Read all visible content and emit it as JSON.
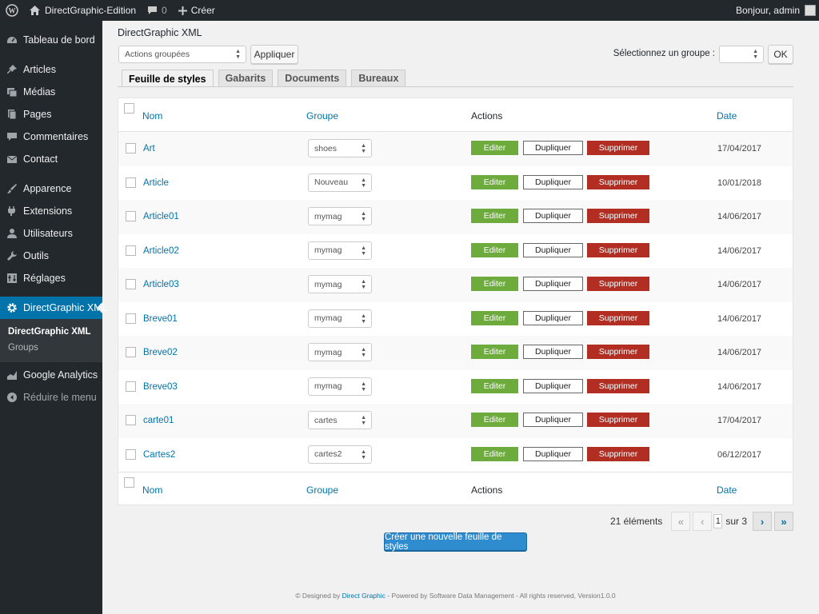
{
  "adminbar": {
    "site_name": "DirectGraphic-Edition",
    "comments_count": "0",
    "new_label": "Créer",
    "greeting": "Bonjour, admin",
    "icons": [
      "wordpress-icon",
      "home-icon",
      "comment-icon",
      "plus-icon"
    ]
  },
  "sidebar": {
    "items": [
      {
        "label": "Tableau de bord",
        "icon": "dashboard-icon"
      },
      {
        "label": "Articles",
        "icon": "pin-icon"
      },
      {
        "label": "Médias",
        "icon": "media-icon"
      },
      {
        "label": "Pages",
        "icon": "page-icon"
      },
      {
        "label": "Commentaires",
        "icon": "comment-icon"
      },
      {
        "label": "Contact",
        "icon": "mail-icon"
      },
      {
        "label": "Apparence",
        "icon": "brush-icon"
      },
      {
        "label": "Extensions",
        "icon": "plugin-icon"
      },
      {
        "label": "Utilisateurs",
        "icon": "user-icon"
      },
      {
        "label": "Outils",
        "icon": "wrench-icon"
      },
      {
        "label": "Réglages",
        "icon": "settings-icon"
      },
      {
        "label": "DirectGraphic XML",
        "icon": "gear-icon"
      },
      {
        "label": "Google Analytics",
        "icon": "analytics-icon"
      },
      {
        "label": "Réduire le menu",
        "icon": "collapse-icon"
      }
    ],
    "submenu": [
      {
        "label": "DirectGraphic XML"
      },
      {
        "label": "Groups"
      }
    ],
    "active_color": "#0073aa"
  },
  "page": {
    "heading": "DirectGraphic XML",
    "bulk_select": "Actions groupées",
    "apply_label": "Appliquer",
    "group_label": "Sélectionnez un groupe :",
    "group_select": "",
    "ok_label": "OK"
  },
  "tabs": [
    {
      "label": "Feuille de styles",
      "active": true
    },
    {
      "label": "Gabarits",
      "active": false
    },
    {
      "label": "Documents",
      "active": false
    },
    {
      "label": "Bureaux",
      "active": false
    }
  ],
  "table": {
    "columns": {
      "nom": "Nom",
      "groupe": "Groupe",
      "actions": "Actions",
      "date": "Date"
    },
    "buttons": {
      "edit": "Editer",
      "duplicate": "Dupliquer",
      "delete": "Supprimer"
    },
    "rows": [
      {
        "nom": "Art",
        "groupe": "shoes",
        "date": "17/04/2017"
      },
      {
        "nom": "Article",
        "groupe": "Nouveau",
        "date": "10/01/2018"
      },
      {
        "nom": "Article01",
        "groupe": "mymag",
        "date": "14/06/2017"
      },
      {
        "nom": "Article02",
        "groupe": "mymag",
        "date": "14/06/2017"
      },
      {
        "nom": "Article03",
        "groupe": "mymag",
        "date": "14/06/2017"
      },
      {
        "nom": "Breve01",
        "groupe": "mymag",
        "date": "14/06/2017"
      },
      {
        "nom": "Breve02",
        "groupe": "mymag",
        "date": "14/06/2017"
      },
      {
        "nom": "Breve03",
        "groupe": "mymag",
        "date": "14/06/2017"
      },
      {
        "nom": "carte01",
        "groupe": "cartes",
        "date": "17/04/2017"
      },
      {
        "nom": "Cartes2",
        "groupe": "cartes2",
        "date": "06/12/2017"
      }
    ],
    "colors": {
      "edit": "#6cab3c",
      "delete": "#b22d22"
    }
  },
  "pagination": {
    "count": "21 éléments",
    "first": "«",
    "prev": "‹",
    "current": "1",
    "of_total": "sur 3",
    "next": "›",
    "last": "»"
  },
  "create_button": "Créer une nouvelle feuille de styles",
  "footer": {
    "prefix": "© Designed by",
    "link": "Direct Graphic",
    "suffix": "- Powered by Software Data Management - All rights reserved,",
    "version": "Version1.0.0"
  }
}
